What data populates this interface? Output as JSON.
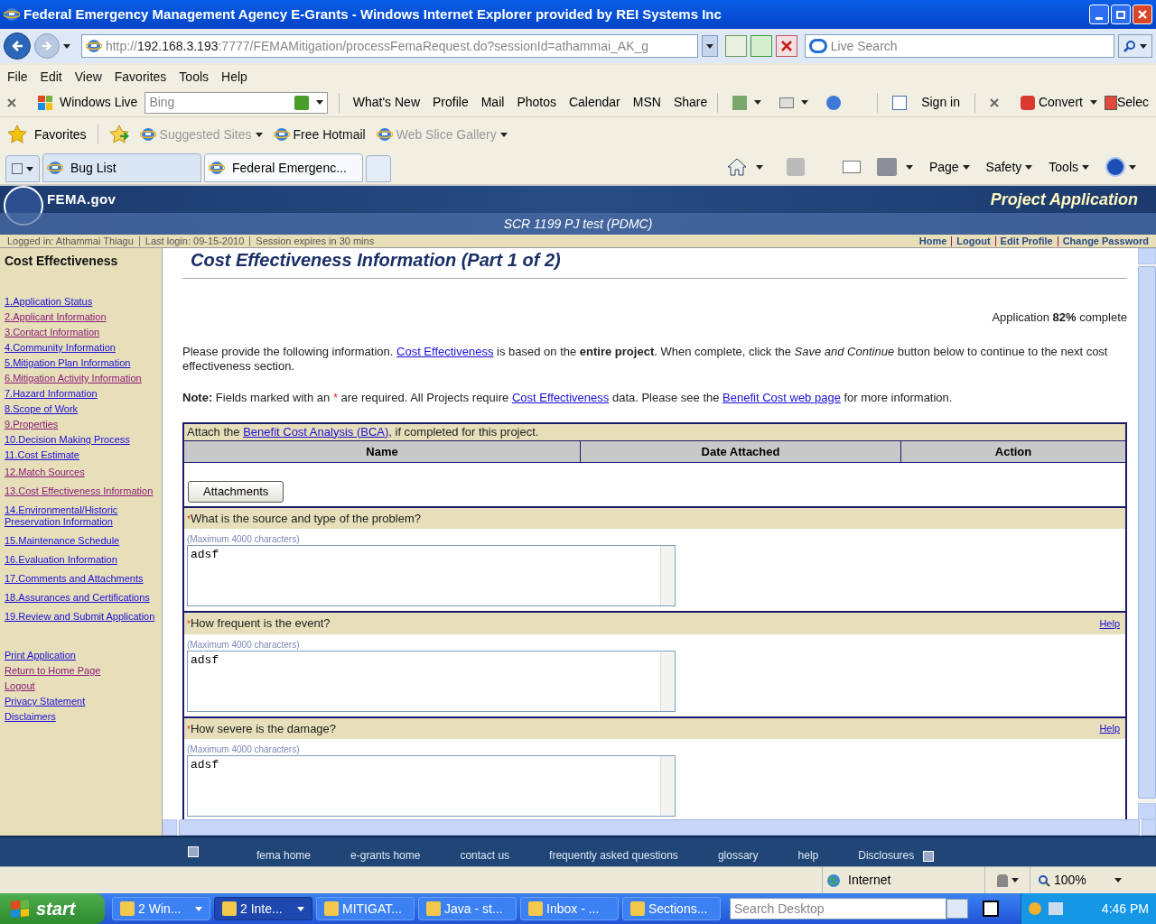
{
  "window": {
    "title": "Federal Emergency Management Agency E-Grants - Windows Internet Explorer provided by REI Systems Inc"
  },
  "address": {
    "host": "http://192.168.3.193",
    "rest": ":7777/FEMAMitigation/processFemaRequest.do?sessionId=athammai_AK_g"
  },
  "search": {
    "placeholder": "Live Search"
  },
  "menu": [
    "File",
    "Edit",
    "View",
    "Favorites",
    "Tools",
    "Help"
  ],
  "live_toolbar": {
    "brand": "Windows Live",
    "search_placeholder": "Bing",
    "links": [
      "What's New",
      "Profile",
      "Mail",
      "Photos",
      "Calendar",
      "MSN",
      "Share"
    ],
    "sign_in": "Sign in",
    "convert": "Convert",
    "select": "Selec"
  },
  "favorites_bar": {
    "favorites": "Favorites",
    "items": [
      {
        "label": "Suggested Sites",
        "dim": true,
        "menu": true
      },
      {
        "label": "Free Hotmail",
        "dim": false,
        "menu": false
      },
      {
        "label": "Web Slice Gallery",
        "dim": true,
        "menu": true
      }
    ]
  },
  "tabs": [
    {
      "label": "Bug List",
      "selected": false
    },
    {
      "label": "Federal Emergenc...",
      "selected": true
    }
  ],
  "command_bar": [
    "Page",
    "Safety",
    "Tools"
  ],
  "site": {
    "logo": "FEMA.gov",
    "section": "Project Application",
    "project": "SCR 1199 PJ test (PDMC)"
  },
  "session": {
    "items": [
      "Logged in: Athammai Thiagu",
      "Last login: 09-15-2010",
      "Session expires in 30 mins"
    ],
    "links": [
      "Home",
      "Logout",
      "Edit Profile",
      "Change Password"
    ]
  },
  "sidebar": {
    "title": "Cost Effectiveness",
    "items": [
      {
        "label": "1.Application Status",
        "visited": false
      },
      {
        "label": "2.Applicant Information",
        "visited": true
      },
      {
        "label": "3.Contact Information",
        "visited": true
      },
      {
        "label": "4.Community Information",
        "visited": false
      },
      {
        "label": "5.Mitigation Plan Information",
        "visited": false
      },
      {
        "label": "6.Mitigation Activity Information",
        "visited": true
      },
      {
        "label": "7.Hazard Information",
        "visited": false
      },
      {
        "label": "8.Scope of Work",
        "visited": false
      },
      {
        "label": "9.Properties",
        "visited": true
      },
      {
        "label": "10.Decision Making Process",
        "visited": false
      },
      {
        "label": "11.Cost Estimate",
        "visited": false
      },
      {
        "label": "12.Match Sources",
        "visited": true
      },
      {
        "label": "13.Cost Effectiveness Information",
        "visited": true
      },
      {
        "label": "14.Environmental/Historic Preservation Information",
        "visited": false
      },
      {
        "label": "15.Maintenance Schedule",
        "visited": false
      },
      {
        "label": "16.Evaluation Information",
        "visited": false
      },
      {
        "label": "17.Comments and Attachments",
        "visited": false
      },
      {
        "label": "18.Assurances and Certifications",
        "visited": false
      },
      {
        "label": "19.Review and Submit Application",
        "visited": false
      }
    ],
    "links": [
      {
        "label": "Print Application",
        "visited": false
      },
      {
        "label": "Return to Home Page",
        "visited": true
      },
      {
        "label": "Logout",
        "visited": true
      },
      {
        "label": "Privacy Statement",
        "visited": false
      },
      {
        "label": "Disclaimers",
        "visited": false
      }
    ]
  },
  "page": {
    "title": "Cost Effectiveness Information (Part 1 of 2)",
    "progress": "Application **82%** complete",
    "intro": [
      {
        "kind": "text",
        "text": "Please provide the following information. "
      },
      {
        "kind": "link",
        "text": "Cost Effectiveness"
      },
      {
        "kind": "text",
        "text": " is based on the **entire project**. When complete, click the *Save and Continue* button below to continue to the next cost effectiveness section."
      }
    ],
    "note": [
      {
        "kind": "text",
        "text": "**Note:** Fields marked with an "
      },
      {
        "kind": "required",
        "text": "*"
      },
      {
        "kind": "text",
        "text": " are required. All Projects require "
      },
      {
        "kind": "link",
        "text": "Cost Effectiveness"
      },
      {
        "kind": "text",
        "text": " data. Please see the "
      },
      {
        "kind": "link",
        "text": "Benefit Cost web page"
      },
      {
        "kind": "text",
        "text": " for more information."
      }
    ],
    "attach": {
      "caption": [
        {
          "kind": "text",
          "text": "Attach the "
        },
        {
          "kind": "link",
          "text": "Benefit Cost Analysis (BCA)"
        },
        {
          "kind": "text",
          "text": ", if completed for this project."
        }
      ],
      "columns": [
        "Name",
        "Date Attached",
        "Action"
      ],
      "button": "Attachments"
    },
    "questions": [
      {
        "mark": "*",
        "label": "What is the source and type of the problem?",
        "hint": "(Maximum 4000 characters)",
        "value": "adsf"
      },
      {
        "mark": "*",
        "label": "How frequent is the event?",
        "help": "Help",
        "hint": "(Maximum 4000 characters)",
        "value": "adsf"
      },
      {
        "mark": "*",
        "label": "How severe is the damage?",
        "help": "Help",
        "hint": "(Maximum 4000 characters)",
        "value": "adsf"
      }
    ]
  },
  "footer": [
    "fema home",
    "e-grants home",
    "contact us",
    "frequently asked questions",
    "glossary",
    "help",
    "Disclosures"
  ],
  "status_bar": {
    "zone": "Internet",
    "zoom": "100%"
  },
  "taskbar": {
    "start": "start",
    "items": [
      {
        "label": "2 Win...",
        "selected": false,
        "menu": true
      },
      {
        "label": "2 Inte...",
        "selected": true,
        "menu": true
      },
      {
        "label": "MITIGAT...",
        "selected": false,
        "menu": false
      },
      {
        "label": "Java - st...",
        "selected": false,
        "menu": false
      },
      {
        "label": "Inbox - ...",
        "selected": false,
        "menu": false
      },
      {
        "label": "Sections...",
        "selected": false,
        "menu": false
      }
    ],
    "search_placeholder": "Search Desktop",
    "clock": "4:46 PM"
  }
}
